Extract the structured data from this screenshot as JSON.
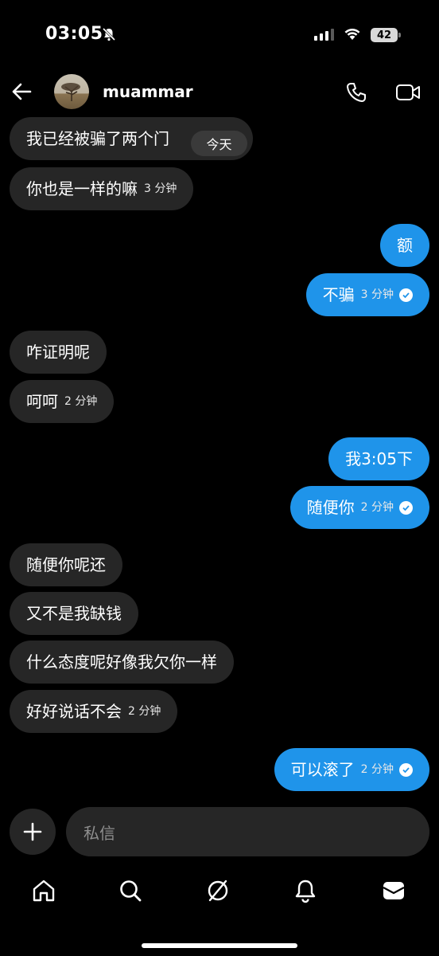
{
  "status_bar": {
    "time": "03:05",
    "battery": "42"
  },
  "header": {
    "username": "muammar"
  },
  "date_separator": "今天",
  "messages": [
    {
      "text": "我已经被骗了两个门",
      "time": ""
    },
    {
      "text": "你也是一样的嘛",
      "time": "3 分钟"
    },
    {
      "text": "额",
      "time": ""
    },
    {
      "text": "不骗",
      "time": "3 分钟"
    },
    {
      "text": "咋证明呢",
      "time": ""
    },
    {
      "text": "呵呵",
      "time": "2 分钟"
    },
    {
      "text": "我3:05下",
      "time": ""
    },
    {
      "text": "随便你",
      "time": "2 分钟"
    },
    {
      "text": "随便你呢还",
      "time": ""
    },
    {
      "text": "又不是我缺钱",
      "time": ""
    },
    {
      "text": "什么态度呢好像我欠你一样",
      "time": ""
    },
    {
      "text": "好好说话不会",
      "time": "2 分钟"
    },
    {
      "text": "可以滚了",
      "time": "2 分钟"
    }
  ],
  "composer": {
    "placeholder": "私信"
  },
  "colors": {
    "outgoing": "#1f94ea",
    "incoming": "#262626",
    "background": "#000000"
  }
}
